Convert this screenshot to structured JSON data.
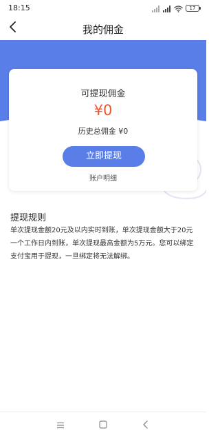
{
  "status_bar": {
    "time": "18:15",
    "battery": "17"
  },
  "header": {
    "title": "我的佣金"
  },
  "card": {
    "label": "可提现佣金",
    "amount": "¥0",
    "history": "历史总佣金 ¥0",
    "withdraw_button": "立即提现",
    "account_detail": "账户明细"
  },
  "rules": {
    "title": "提现规则",
    "body": "单次提现金额20元及以内实时到账，单次提现金额大于20元一个工作日内到账，单次提现最高金额为5万元。您可以绑定支付宝用于提现，一旦绑定将无法解绑。"
  },
  "colors": {
    "accent_blue": "#5a7ee8",
    "amount_red": "#f1552f"
  },
  "icons": {
    "back": "chevron-left-icon",
    "signal": "signal-icon",
    "wifi": "wifi-icon",
    "battery": "battery-icon",
    "menu": "menu-icon",
    "home": "home-square-icon",
    "nav_back": "nav-back-icon",
    "watermark": "money-bag-icon"
  }
}
